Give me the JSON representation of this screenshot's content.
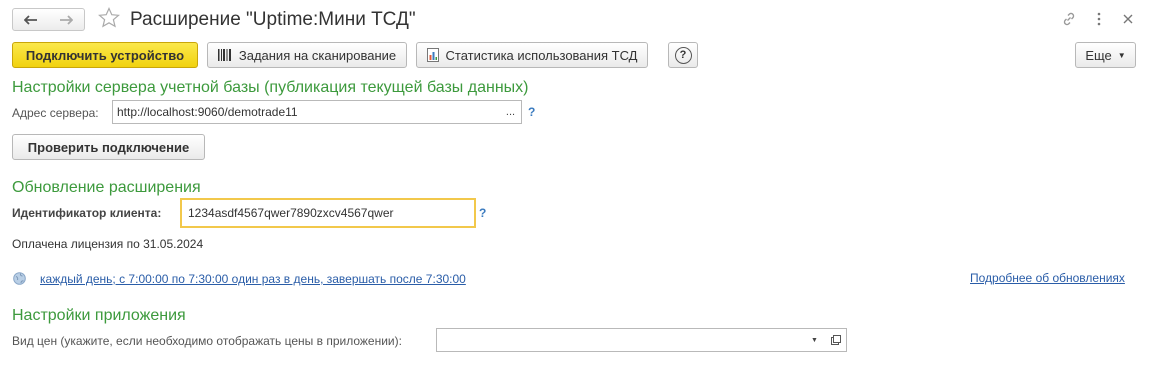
{
  "header": {
    "title": "Расширение \"Uptime:Мини ТСД\""
  },
  "toolbar": {
    "connect_device": "Подключить устройство",
    "scan_tasks": "Задания на сканирование",
    "usage_stats": "Статистика использования ТСД",
    "help": "?",
    "more": "Еще"
  },
  "server_settings": {
    "title": "Настройки сервера учетной базы (публикация текущей базы данных)",
    "address_label": "Адрес сервера:",
    "address_value": "http://localhost:9060/demotrade11",
    "select_btn": "...",
    "help": "?",
    "check_button": "Проверить подключение"
  },
  "extension_update": {
    "title": "Обновление расширения",
    "client_id_label": "Идентификатор клиента:",
    "client_id_value": "1234asdf4567qwer7890zxcv4567qwer",
    "help": "?",
    "license_text": "Оплачена лицензия по 31.05.2024",
    "schedule_link": "каждый день; с 7:00:00 по 7:30:00 один раз в день, завершать после 7:30:00",
    "more_link": "Подробнее об обновлениях"
  },
  "app_settings": {
    "title": "Настройки приложения",
    "price_type_label": "Вид цен (укажите, если необходимо отображать цены в приложении):",
    "price_type_value": ""
  },
  "colors": {
    "accent_green": "#3d9a3d",
    "primary_yellow": "#f1d20f",
    "link_blue": "#2a5da8",
    "focus_border": "#f2c84b"
  }
}
